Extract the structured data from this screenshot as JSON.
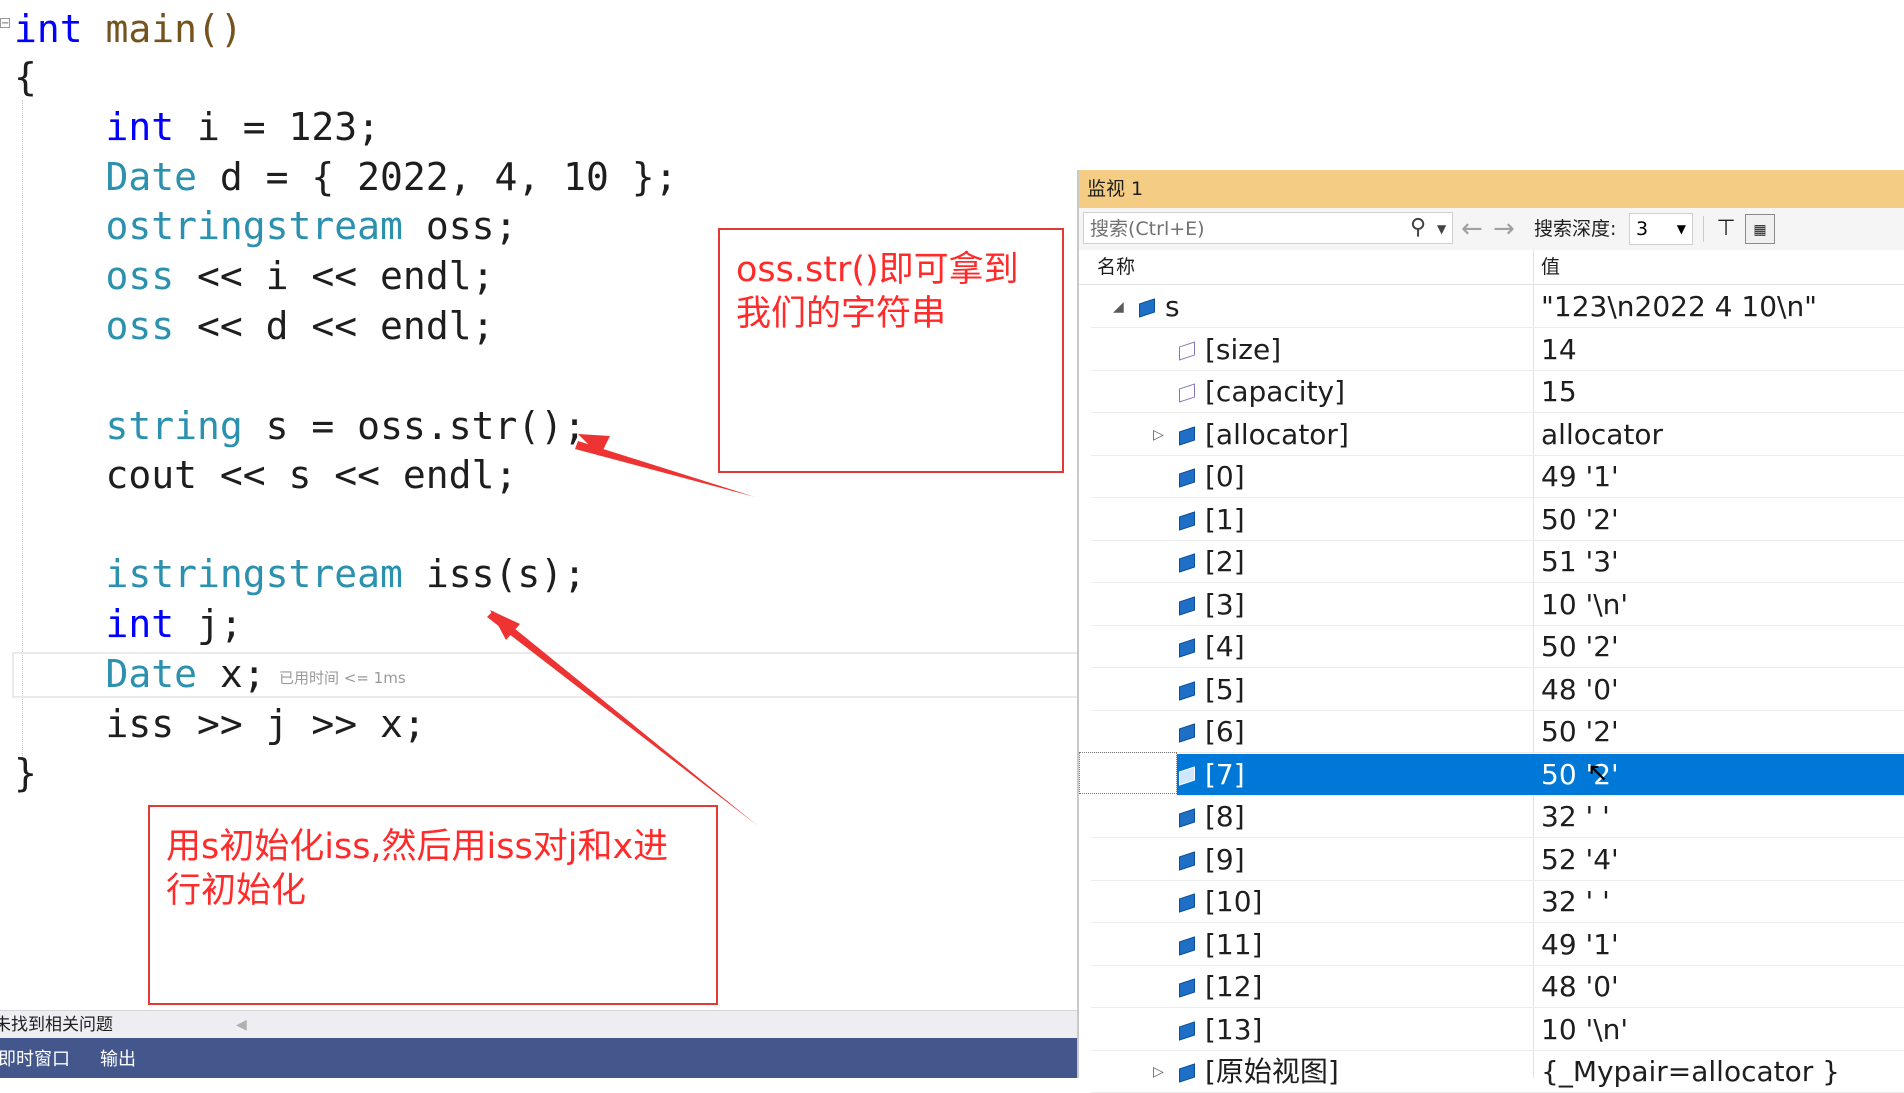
{
  "editor": {
    "lines": [
      [
        {
          "t": "int",
          "c": "kw"
        },
        {
          "t": " main()",
          "c": "fn"
        }
      ],
      [
        {
          "t": "{",
          "c": "tx"
        }
      ],
      [
        {
          "t": "    "
        },
        {
          "t": "int",
          "c": "kw"
        },
        {
          "t": " i = 123;",
          "c": "tx"
        }
      ],
      [
        {
          "t": "    "
        },
        {
          "t": "Date",
          "c": "ty"
        },
        {
          "t": " d = { 2022, 4, 10 };",
          "c": "tx"
        }
      ],
      [
        {
          "t": "    "
        },
        {
          "t": "ostringstream",
          "c": "ty"
        },
        {
          "t": " oss;",
          "c": "tx"
        }
      ],
      [
        {
          "t": "    "
        },
        {
          "t": "oss",
          "c": "ty"
        },
        {
          "t": " << i << endl;",
          "c": "tx"
        }
      ],
      [
        {
          "t": "    "
        },
        {
          "t": "oss",
          "c": "ty"
        },
        {
          "t": " << d << endl;",
          "c": "tx"
        }
      ],
      [
        {
          "t": ""
        }
      ],
      [
        {
          "t": "    "
        },
        {
          "t": "string",
          "c": "ty"
        },
        {
          "t": " s = oss.str();",
          "c": "tx"
        }
      ],
      [
        {
          "t": "    "
        },
        {
          "t": "cout << s << endl;",
          "c": "tx"
        }
      ],
      [
        {
          "t": ""
        }
      ],
      [
        {
          "t": "    "
        },
        {
          "t": "istringstream",
          "c": "ty"
        },
        {
          "t": " iss(s);",
          "c": "tx"
        }
      ],
      [
        {
          "t": "    "
        },
        {
          "t": "int",
          "c": "kw"
        },
        {
          "t": " j;",
          "c": "tx"
        }
      ],
      [
        {
          "t": "    "
        },
        {
          "t": "Date",
          "c": "ty"
        },
        {
          "t": " x;",
          "c": "tx"
        }
      ],
      [
        {
          "t": "    "
        },
        {
          "t": "iss >> j >> x;",
          "c": "tx"
        }
      ],
      [
        {
          "t": "}",
          "c": "tx"
        }
      ]
    ],
    "elapsed_hint": "已用时间 <= 1ms"
  },
  "annotations": {
    "note1": "oss.str()即可拿到我们的字符串",
    "note2": "用s初始化iss,然后用iss对j和x进行初始化"
  },
  "bottom": {
    "problems_text": "未找到相关问题",
    "tabs": [
      "即时窗口",
      "输出"
    ]
  },
  "watch": {
    "title": "监视 1",
    "search_placeholder": "搜索(Ctrl+E)",
    "depth_label": "搜索深度:",
    "depth_value": "3",
    "col_name": "名称",
    "col_value": "值",
    "rows": [
      {
        "name": "s",
        "value": "\"123\\n2022 4 10\\n\"",
        "level": 0,
        "expander": "expanded",
        "icon": "object"
      },
      {
        "name": "[size]",
        "value": "14",
        "level": 1,
        "expander": "none",
        "icon": "property"
      },
      {
        "name": "[capacity]",
        "value": "15",
        "level": 1,
        "expander": "none",
        "icon": "property"
      },
      {
        "name": "[allocator]",
        "value": "allocator",
        "level": 1,
        "expander": "collapsed",
        "icon": "object"
      },
      {
        "name": "[0]",
        "value": "49 '1'",
        "level": 1,
        "expander": "none",
        "icon": "object"
      },
      {
        "name": "[1]",
        "value": "50 '2'",
        "level": 1,
        "expander": "none",
        "icon": "object"
      },
      {
        "name": "[2]",
        "value": "51 '3'",
        "level": 1,
        "expander": "none",
        "icon": "object"
      },
      {
        "name": "[3]",
        "value": "10 '\\n'",
        "level": 1,
        "expander": "none",
        "icon": "object"
      },
      {
        "name": "[4]",
        "value": "50 '2'",
        "level": 1,
        "expander": "none",
        "icon": "object"
      },
      {
        "name": "[5]",
        "value": "48 '0'",
        "level": 1,
        "expander": "none",
        "icon": "object"
      },
      {
        "name": "[6]",
        "value": "50 '2'",
        "level": 1,
        "expander": "none",
        "icon": "object"
      },
      {
        "name": "[7]",
        "value": "50 '2'",
        "level": 1,
        "expander": "none",
        "icon": "object",
        "selected": true
      },
      {
        "name": "[8]",
        "value": "32 ' '",
        "level": 1,
        "expander": "none",
        "icon": "object"
      },
      {
        "name": "[9]",
        "value": "52 '4'",
        "level": 1,
        "expander": "none",
        "icon": "object"
      },
      {
        "name": "[10]",
        "value": "32 ' '",
        "level": 1,
        "expander": "none",
        "icon": "object"
      },
      {
        "name": "[11]",
        "value": "49 '1'",
        "level": 1,
        "expander": "none",
        "icon": "object"
      },
      {
        "name": "[12]",
        "value": "48 '0'",
        "level": 1,
        "expander": "none",
        "icon": "object"
      },
      {
        "name": "[13]",
        "value": "10 '\\n'",
        "level": 1,
        "expander": "none",
        "icon": "object"
      },
      {
        "name": "[原始视图]",
        "value": "{_Mypair=allocator }",
        "level": 1,
        "expander": "collapsed",
        "icon": "object"
      }
    ]
  },
  "colors": {
    "keyword": "#0000ff",
    "type": "#2b91af",
    "annotation": "#ff2a2a",
    "selection": "#0078d7",
    "watch_title_bg": "#f5cc84",
    "bottom_tab_bg": "#43578c"
  },
  "icons": {
    "search": "magnifier-icon",
    "back": "arrow-left-icon",
    "forward": "arrow-right-icon",
    "pin": "pin-icon",
    "hex": "hex-display-icon"
  }
}
